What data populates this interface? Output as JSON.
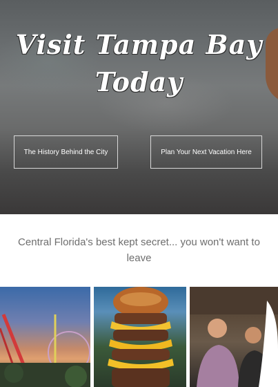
{
  "hero": {
    "title_line1": "Visit Tampa Bay",
    "title_line2": "Today",
    "buttons": [
      {
        "label": "The History Behind the City"
      },
      {
        "label": "Plan Your Next Vacation Here"
      }
    ]
  },
  "tagline": "Central Florida's best kept secret... you won't want to leave",
  "gallery": [
    {
      "subject": "amusement-park"
    },
    {
      "subject": "stacked-cheeseburger"
    },
    {
      "subject": "friends-dining"
    }
  ]
}
